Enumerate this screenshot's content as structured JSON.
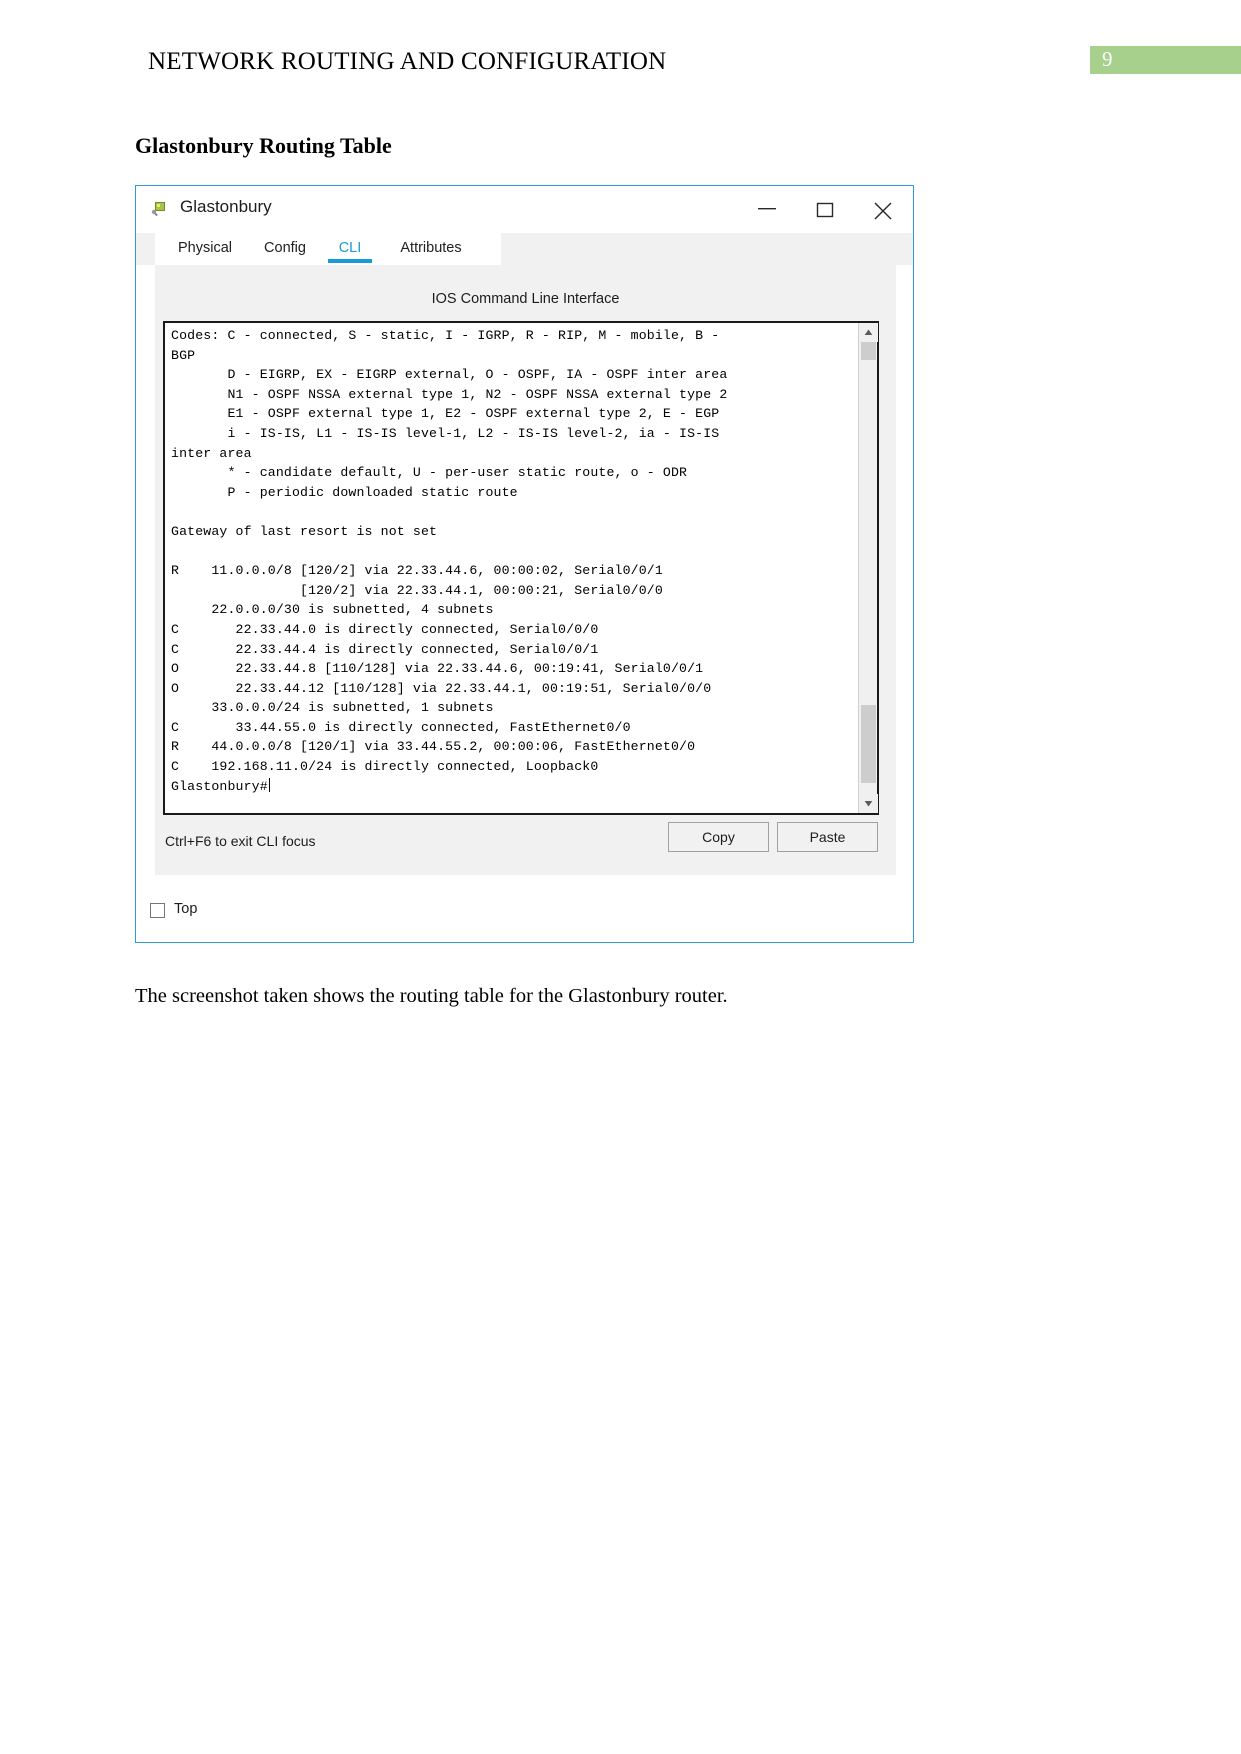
{
  "document": {
    "header_title": "NETWORK ROUTING AND CONFIGURATION",
    "page_number": "9",
    "page_badge_color": "#a8d08d",
    "section_heading": "Glastonbury Routing Table",
    "caption": "The screenshot taken shows the routing table for the Glastonbury router."
  },
  "window": {
    "title": "Glastonbury",
    "border_color": "#2e9bd6",
    "controls": {
      "minimize": "minimize-icon",
      "maximize": "maximize-icon",
      "close": "close-icon"
    },
    "tabs": [
      {
        "label": "Physical",
        "active": false
      },
      {
        "label": "Config",
        "active": false
      },
      {
        "label": "CLI",
        "active": true
      },
      {
        "label": "Attributes",
        "active": false
      }
    ],
    "active_tab_color": "#1a9ad6",
    "cli_panel_heading": "IOS Command Line Interface",
    "terminal_output": "Codes: C - connected, S - static, I - IGRP, R - RIP, M - mobile, B -\nBGP\n       D - EIGRP, EX - EIGRP external, O - OSPF, IA - OSPF inter area\n       N1 - OSPF NSSA external type 1, N2 - OSPF NSSA external type 2\n       E1 - OSPF external type 1, E2 - OSPF external type 2, E - EGP\n       i - IS-IS, L1 - IS-IS level-1, L2 - IS-IS level-2, ia - IS-IS\ninter area\n       * - candidate default, U - per-user static route, o - ODR\n       P - periodic downloaded static route\n\nGateway of last resort is not set\n\nR    11.0.0.0/8 [120/2] via 22.33.44.6, 00:00:02, Serial0/0/1\n                [120/2] via 22.33.44.1, 00:00:21, Serial0/0/0\n     22.0.0.0/30 is subnetted, 4 subnets\nC       22.33.44.0 is directly connected, Serial0/0/0\nC       22.33.44.4 is directly connected, Serial0/0/1\nO       22.33.44.8 [110/128] via 22.33.44.6, 00:19:41, Serial0/0/1\nO       22.33.44.12 [110/128] via 22.33.44.1, 00:19:51, Serial0/0/0\n     33.0.0.0/24 is subnetted, 1 subnets\nC       33.44.55.0 is directly connected, FastEthernet0/0\nR    44.0.0.0/8 [120/1] via 33.44.55.2, 00:00:06, FastEthernet0/0\nC    192.168.11.0/24 is directly connected, Loopback0\n",
    "terminal_prompt": "Glastonbury#",
    "cli_focus_hint": "Ctrl+F6 to exit CLI focus",
    "buttons": {
      "copy": "Copy",
      "paste": "Paste"
    },
    "top_checkbox": {
      "label": "Top",
      "checked": false
    }
  }
}
